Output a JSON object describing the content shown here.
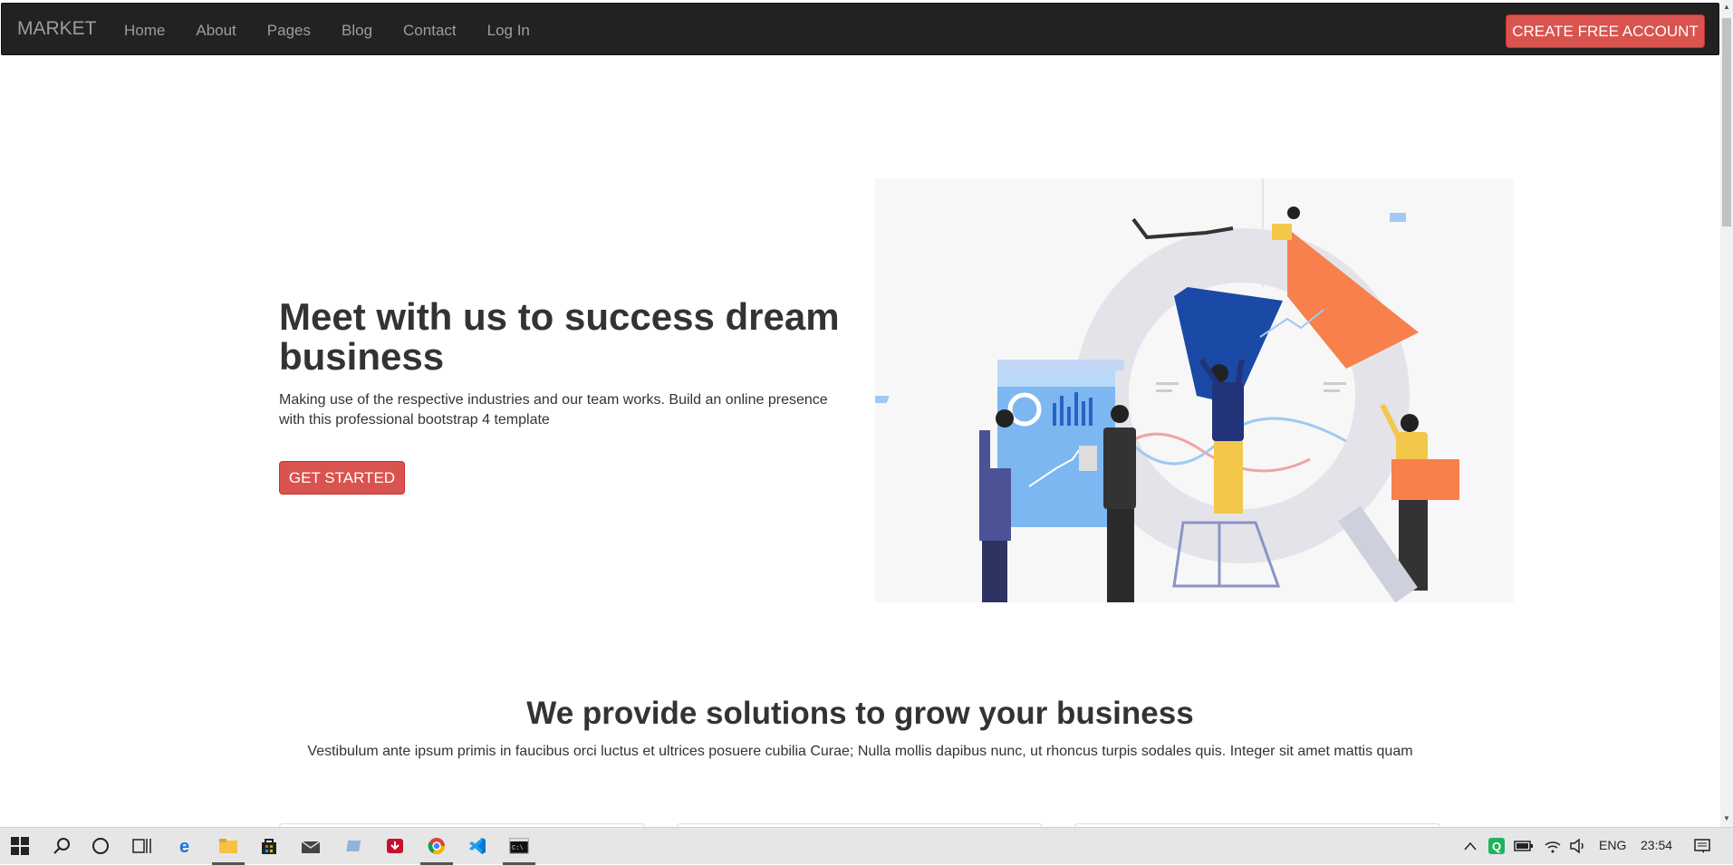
{
  "navbar": {
    "brand": "MARKET",
    "items": [
      "Home",
      "About",
      "Pages",
      "Blog",
      "Contact",
      "Log In"
    ],
    "cta": "CREATE FREE ACCOUNT"
  },
  "hero": {
    "title": "Meet with us to success dream business",
    "text": "Making use of the respective industries and our team works. Build an online presence with this professional bootstrap 4 template",
    "button": "GET STARTED"
  },
  "solutions": {
    "title": "We provide solutions to grow your business",
    "text": "Vestibulum ante ipsum primis in faucibus orci luctus et ultrices posuere cubilia Curae; Nulla mollis dapibus nunc, ut rhoncus turpis sodales quis. Integer sit amet mattis quam"
  },
  "colors": {
    "navbar": "#222222",
    "accent": "#d9534f",
    "text": "#333333",
    "nav_text": "#9d9d9d"
  },
  "taskbar": {
    "icons": [
      "windows-start-icon",
      "search-icon",
      "cortana-icon",
      "task-view-icon",
      "edge-icon",
      "file-explorer-icon",
      "store-icon",
      "mail-icon",
      "app-icon",
      "download-icon",
      "chrome-icon",
      "vscode-icon",
      "terminal-icon"
    ],
    "language": "ENG",
    "time": "23:54"
  }
}
